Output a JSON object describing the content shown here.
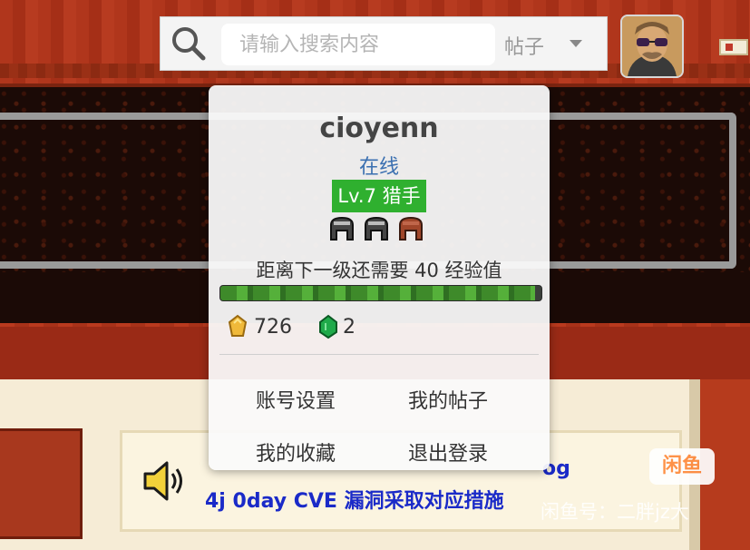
{
  "search": {
    "placeholder": "请输入搜索内容",
    "category_selected": "帖子"
  },
  "user_card": {
    "username": "cioyenn",
    "status": "在线",
    "level": "Lv.7 猎手",
    "exp_text": "距离下一级还需要 40 经验值",
    "exp_progress": 0.98,
    "gold": "726",
    "gems": "2",
    "menu": [
      {
        "label": "账号设置"
      },
      {
        "label": "我的帖子"
      },
      {
        "label": "我的收藏"
      },
      {
        "label": "退出登录"
      }
    ]
  },
  "notice": {
    "suffix": "og",
    "line": "4j 0day CVE 漏洞采取对应措施"
  },
  "watermark": {
    "logo": "闲鱼",
    "text": "闲鱼号：二胖jz大"
  },
  "colors": {
    "header": "#b0361c",
    "level_badge": "#2fb02f",
    "status": "#3a6fb0",
    "notice_link": "#1a2ac8"
  },
  "icons": [
    "search-icon",
    "chevron-down-icon",
    "helmet-icon",
    "gold-icon",
    "gem-icon",
    "speaker-icon"
  ]
}
